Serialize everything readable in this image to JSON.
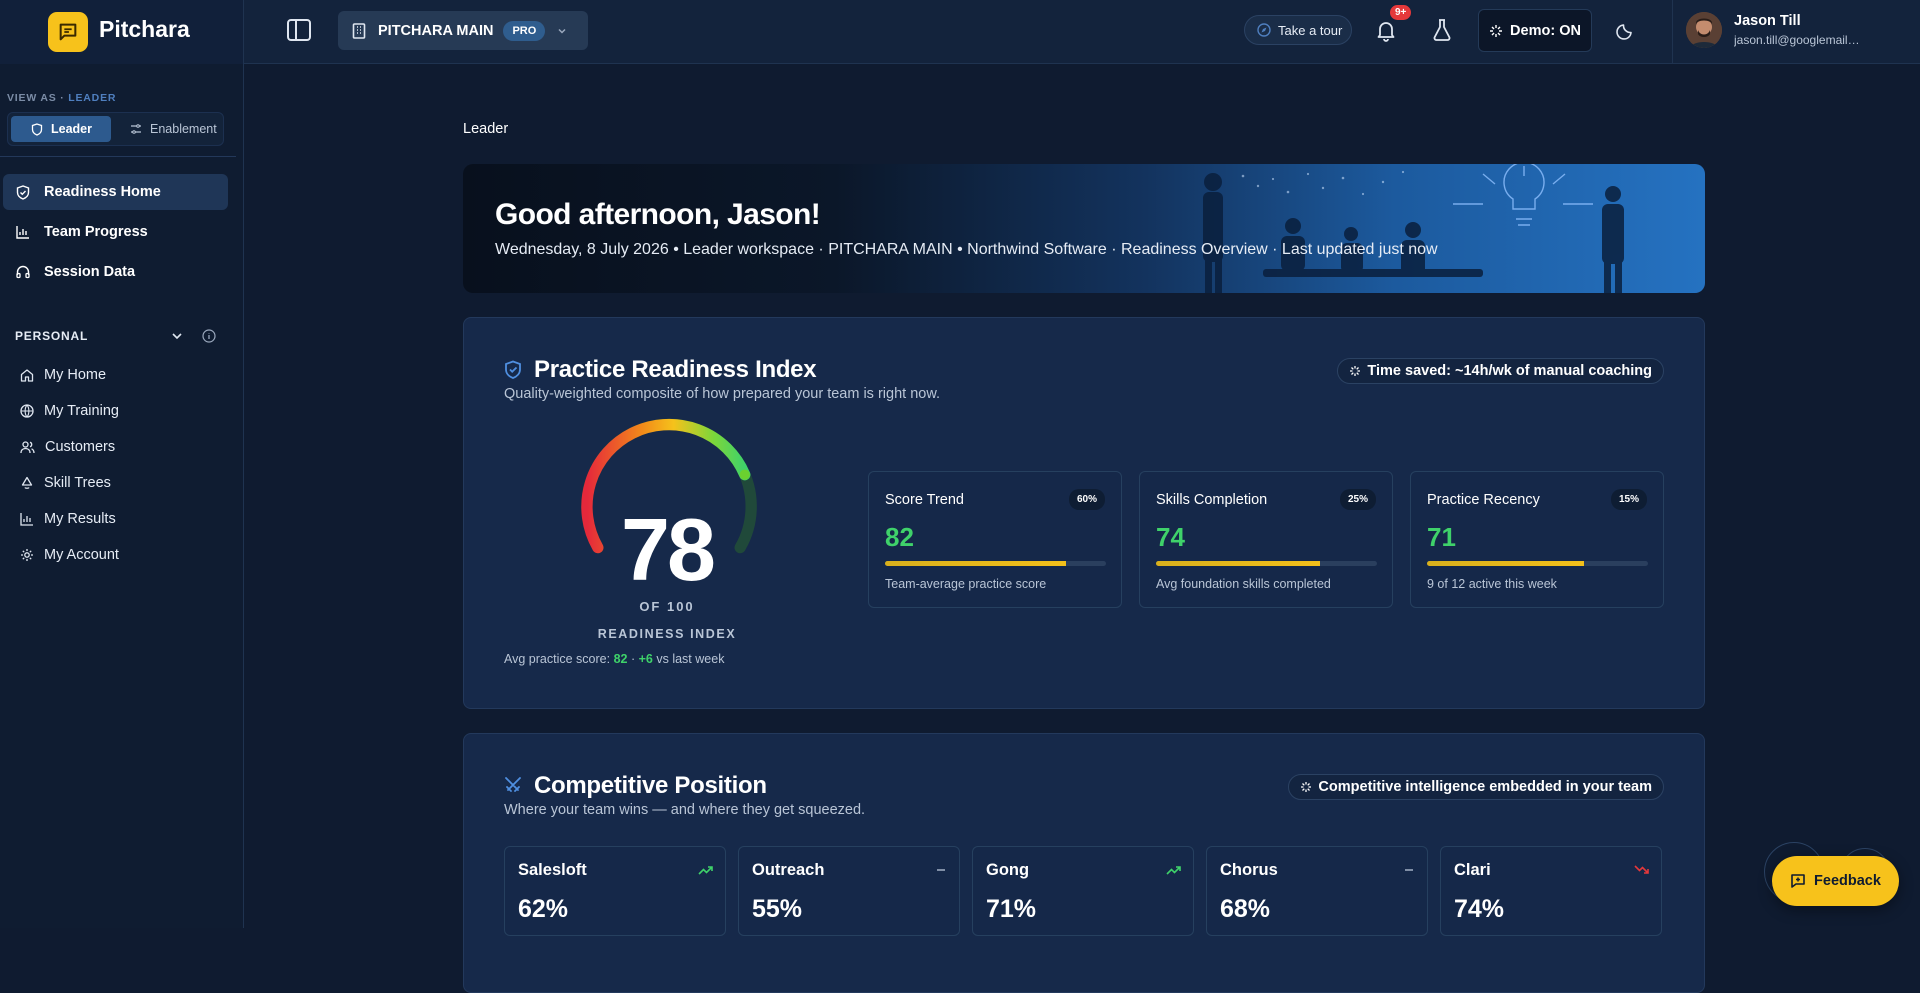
{
  "brand": {
    "name": "Pitchara"
  },
  "workspace": {
    "name": "PITCHARA MAIN",
    "badge": "PRO"
  },
  "topbar": {
    "tour_label": "Take a tour",
    "notif_count": "9+",
    "demo_label": "Demo: ON"
  },
  "user": {
    "name": "Jason Till",
    "email": "jason.till@googlemail.com"
  },
  "sidebar": {
    "view_as_label": "VIEW AS ·",
    "view_as_value": "LEADER",
    "segments": [
      {
        "label": "Leader"
      },
      {
        "label": "Enablement"
      }
    ],
    "main_items": [
      {
        "label": "Readiness Home",
        "icon": "shield-icon"
      },
      {
        "label": "Team Progress",
        "icon": "bar-chart-icon"
      },
      {
        "label": "Session Data",
        "icon": "headphones-icon"
      }
    ],
    "personal_label": "PERSONAL",
    "personal_items": [
      {
        "label": "My Home",
        "icon": "home-icon"
      },
      {
        "label": "My Training",
        "icon": "globe-icon"
      },
      {
        "label": "Customers",
        "icon": "users-icon"
      },
      {
        "label": "Skill Trees",
        "icon": "tree-icon"
      },
      {
        "label": "My Results",
        "icon": "bar-chart-icon"
      },
      {
        "label": "My Account",
        "icon": "gear-icon"
      }
    ]
  },
  "main": {
    "breadcrumb": "Leader",
    "hero": {
      "title": "Good afternoon, Jason!",
      "subtitle": "Wednesday, 8 July 2026 • Leader workspace · PITCHARA MAIN • Northwind Software · Readiness Overview · Last updated just now"
    },
    "readiness": {
      "title": "Practice Readiness Index",
      "subtitle": "Quality-weighted composite of how prepared your team is right now.",
      "pill": "Time saved: ~14h/wk of manual coaching",
      "gauge": {
        "value": "78",
        "max_label": "OF 100",
        "label": "READINESS INDEX",
        "fraction": 0.78
      },
      "avg_prefix": "Avg practice score:",
      "avg_score": "82",
      "avg_sep": "·",
      "avg_delta": "+6",
      "avg_suffix": "vs last week",
      "metrics": [
        {
          "title": "Score Trend",
          "weight": "60%",
          "value": "82",
          "progress": 0.82,
          "desc": "Team-average practice score"
        },
        {
          "title": "Skills Completion",
          "weight": "25%",
          "value": "74",
          "progress": 0.74,
          "desc": "Avg foundation skills completed"
        },
        {
          "title": "Practice Recency",
          "weight": "15%",
          "value": "71",
          "progress": 0.71,
          "desc": "9 of 12 active this week"
        }
      ]
    },
    "competitive": {
      "title": "Competitive Position",
      "subtitle": "Where your team wins — and where they get squeezed.",
      "pill": "Competitive intelligence embedded in your team",
      "competitors": [
        {
          "name": "Salesloft",
          "value": "62%",
          "trend": "up",
          "color": "#3fd26a"
        },
        {
          "name": "Outreach",
          "value": "55%",
          "trend": "flat",
          "color": "#9aa8bd"
        },
        {
          "name": "Gong",
          "value": "71%",
          "trend": "up",
          "color": "#3fd26a"
        },
        {
          "name": "Chorus",
          "value": "68%",
          "trend": "flat",
          "color": "#9aa8bd"
        },
        {
          "name": "Clari",
          "value": "74%",
          "trend": "down",
          "color": "#e5383b"
        }
      ]
    }
  },
  "feedback": {
    "label": "Feedback"
  },
  "colors": {
    "accent": "#f7c21b",
    "positive": "#3fd26a",
    "negative": "#e5383b",
    "brand_blue": "#2d5a8e"
  }
}
